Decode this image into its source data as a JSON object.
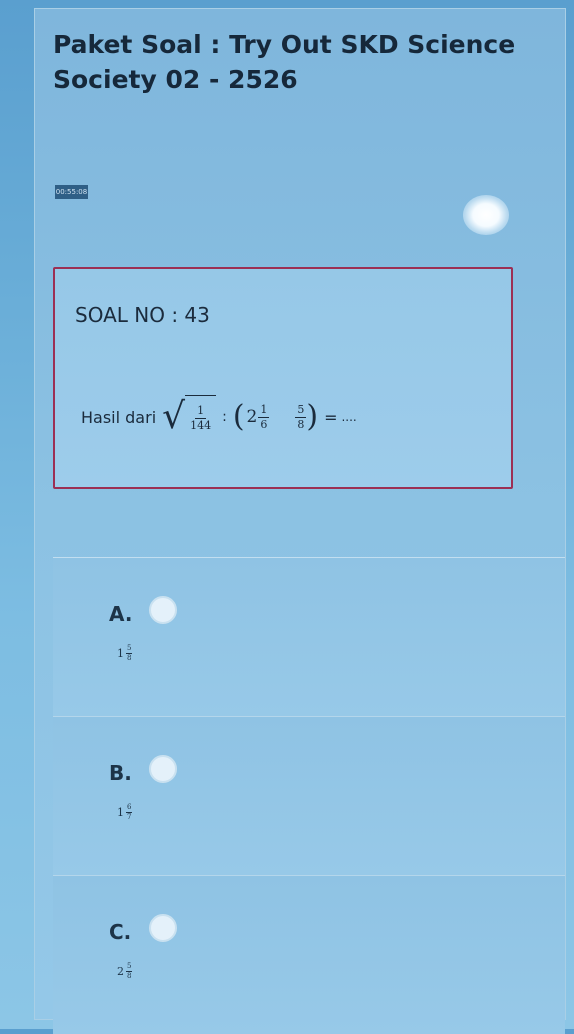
{
  "header": {
    "title": "Paket Soal : Try Out SKD Science Society 02 - 2526"
  },
  "timer": {
    "text": "00:55:08"
  },
  "question": {
    "number_label": "SOAL NO : 43",
    "prefix": "Hasil dari",
    "sqrt_numerator": "1",
    "sqrt_denominator": "144",
    "operator": ":",
    "mixed_whole": "2",
    "mixed_numerator": "1",
    "mixed_denominator": "6",
    "second_numerator": "5",
    "second_denominator": "8",
    "equals": "=",
    "blank": "...."
  },
  "options": [
    {
      "letter": "A.",
      "whole": "1",
      "numerator": "5",
      "denominator": "8"
    },
    {
      "letter": "B.",
      "whole": "1",
      "numerator": "6",
      "denominator": "7"
    },
    {
      "letter": "C.",
      "whole": "2",
      "numerator": "5",
      "denominator": "8"
    }
  ],
  "colors": {
    "question_border": "#9c2f54",
    "background": "#7fb6dc",
    "text": "#16283a"
  }
}
